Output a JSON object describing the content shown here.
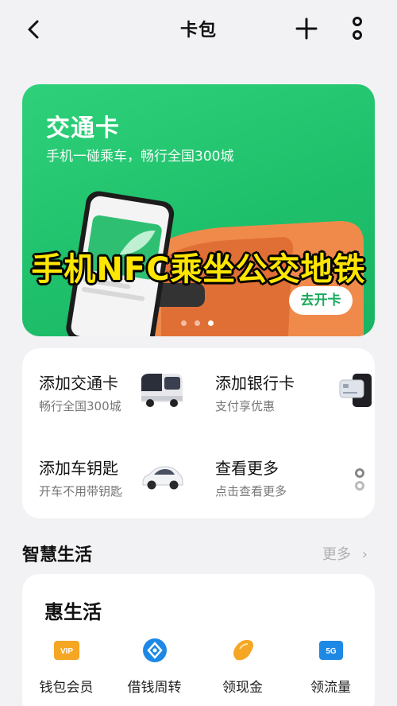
{
  "header": {
    "title": "卡包",
    "back_icon": "chevron-left-icon",
    "add_icon": "plus-icon",
    "more_icon": "vertical-more-icon"
  },
  "banner": {
    "title": "交通卡",
    "subtitle": "手机一碰乘车，畅行全国300城",
    "overlay_caption": "手机NFC乘坐公交地铁",
    "button": "去开卡",
    "carousel_pages": 3,
    "carousel_active": 3,
    "colors": {
      "background": "#22c470",
      "caption": "#ffe600"
    }
  },
  "add_cards": [
    {
      "name": "添加交通卡",
      "desc": "畅行全国300城",
      "icon": "bus-icon"
    },
    {
      "name": "添加银行卡",
      "desc": "支付享优惠",
      "icon": "bank-card-icon"
    },
    {
      "name": "添加车钥匙",
      "desc": "开车不用带钥匙",
      "icon": "car-icon"
    },
    {
      "name": "查看更多",
      "desc": "点击查看更多",
      "icon": "more-dots-icon"
    }
  ],
  "smart_life": {
    "title": "智慧生活",
    "more": "更多",
    "card_title": "惠生活",
    "services": [
      {
        "label": "钱包会员",
        "icon": "vip-icon",
        "color": "#f5a623"
      },
      {
        "label": "借钱周转",
        "icon": "loan-icon",
        "color": "#1e88e5"
      },
      {
        "label": "领现金",
        "icon": "cash-bean-icon",
        "color": "#f5a623"
      },
      {
        "label": "领流量",
        "icon": "sim-5g-icon",
        "color": "#1e88e5"
      }
    ]
  }
}
